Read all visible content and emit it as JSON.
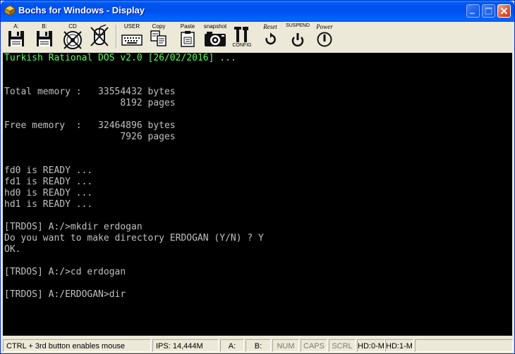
{
  "window": {
    "title": "Bochs for Windows - Display"
  },
  "toolbar": {
    "floppy_a_label": "A:",
    "floppy_b_label": "B:",
    "cdrom_label": "CD",
    "mouse_label": "",
    "user_label": "USER",
    "copy_label": "Copy",
    "paste_label": "Paste",
    "snapshot_label": "snapshot",
    "config_label": "CONFIG",
    "reset_label": "Reset",
    "suspend_label": "SUSPEND",
    "power_label": "Power"
  },
  "console": {
    "lines": [
      "Turkish Rational DOS v2.0 [26/02/2016] ...",
      "",
      "",
      "Total memory :   33554432 bytes",
      "                     8192 pages",
      "",
      "Free memory  :   32464896 bytes",
      "                     7926 pages",
      "",
      "",
      "fd0 is READY ...",
      "fd1 is READY ...",
      "hd0 is READY ...",
      "hd1 is READY ...",
      "",
      "[TRDOS] A:/>mkdir erdogan",
      "Do you want to make directory ERDOGAN (Y/N) ? Y",
      "OK.",
      "",
      "[TRDOS] A:/>cd erdogan",
      "",
      "[TRDOS] A:/ERDOGAN>dir"
    ],
    "banner_color": "#55ff55",
    "text_color": "#c0c0c0"
  },
  "status": {
    "hint": "CTRL + 3rd button enables mouse",
    "ips": "IPS: 14,444M",
    "a": "A:",
    "b": "B:",
    "num": "NUM",
    "caps": "CAPS",
    "scrl": "SCRL",
    "hd0": "HD:0-M",
    "hd1": "HD:1-M"
  }
}
